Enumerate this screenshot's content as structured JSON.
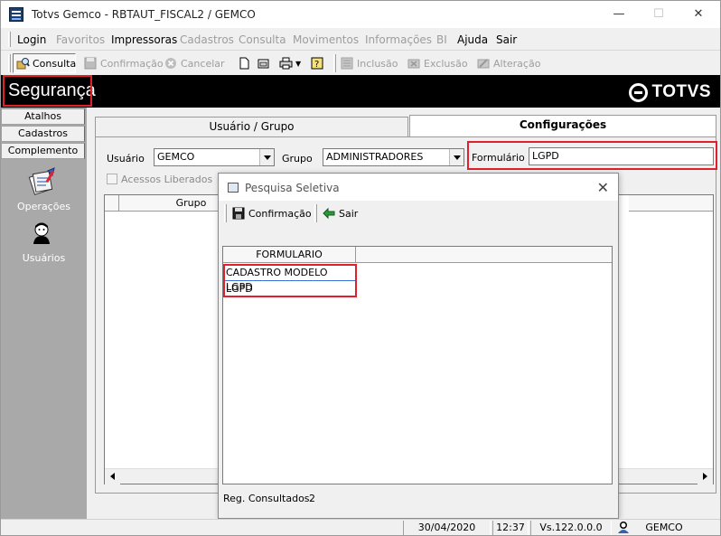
{
  "window": {
    "title": "Totvs Gemco - RBTAUT_FISCAL2 / GEMCO",
    "minimize": "—",
    "maximize": "☐",
    "close": "✕"
  },
  "menu": [
    {
      "label": "Login",
      "enabled": true
    },
    {
      "label": "Favoritos",
      "enabled": false
    },
    {
      "label": "Impressoras",
      "enabled": true
    },
    {
      "label": "Cadastros",
      "enabled": false
    },
    {
      "label": "Consulta",
      "enabled": false
    },
    {
      "label": "Movimentos",
      "enabled": false
    },
    {
      "label": "Informações",
      "enabled": false
    },
    {
      "label": "BI",
      "enabled": false
    },
    {
      "label": "Ajuda",
      "enabled": true
    },
    {
      "label": "Sair",
      "enabled": true
    }
  ],
  "toolbar": {
    "consulta": "Consulta",
    "confirmacao": "Confirmação",
    "cancelar": "Cancelar",
    "inclusao": "Inclusão",
    "exclusao": "Exclusão",
    "alteracao": "Alteração"
  },
  "header": {
    "title": "Segurança",
    "logo": "TOTVS",
    "background": "#000000"
  },
  "sidebar": {
    "tabs": [
      "Atalhos",
      "Cadastros",
      "Complemento"
    ],
    "items": [
      {
        "label": "Operações",
        "icon": "operations-icon"
      },
      {
        "label": "Usuários",
        "icon": "users-icon"
      }
    ]
  },
  "tabs": {
    "inactive": "Usuário  / Grupo",
    "active": "Configurações"
  },
  "form": {
    "usuario_label": "Usuário",
    "usuario_value": "GEMCO",
    "grupo_label": "Grupo",
    "grupo_value": "ADMINISTRADORES",
    "formulario_label": "Formulário",
    "formulario_value": "LGPD",
    "acessos_label": "Acessos Liberados"
  },
  "grid": {
    "column_grupo": "Grupo"
  },
  "dialog": {
    "title": "Pesquisa Seletiva",
    "confirm_button": "Confirmação",
    "exit_button": "Sair",
    "column_header": "FORMULARIO",
    "rows": [
      "CADASTRO MODELO LGPD",
      "LGPD"
    ],
    "footer_label": "Reg. Consultados",
    "footer_count": "2"
  },
  "status": {
    "date": "30/04/2020",
    "time": "12:37",
    "version": "Vs.122.0.0.0",
    "user": "GEMCO"
  },
  "colors": {
    "highlight": "#e0202a",
    "sidebar": "#a9a9a9"
  }
}
